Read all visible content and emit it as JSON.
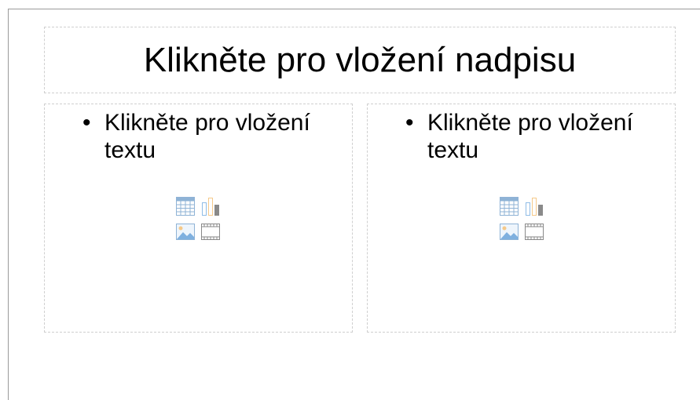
{
  "slide": {
    "title_placeholder": "Klikněte pro vložení nadpisu",
    "content_left": {
      "bullet_char": "•",
      "text": "Klikněte pro vložení textu",
      "insert_icons": [
        "insert-table-icon",
        "insert-chart-icon",
        "insert-image-icon",
        "insert-video-icon"
      ]
    },
    "content_right": {
      "bullet_char": "•",
      "text": "Klikněte pro vložení textu",
      "insert_icons": [
        "insert-table-icon",
        "insert-chart-icon",
        "insert-image-icon",
        "insert-video-icon"
      ]
    }
  },
  "colors": {
    "placeholder_border": "#cfcfcf",
    "table_icon": "#8fb3d6",
    "chart_blue": "#8fbce6",
    "chart_orange": "#f5c98a",
    "chart_gray": "#8a8a8a",
    "image_icon": "#7fb0df"
  }
}
